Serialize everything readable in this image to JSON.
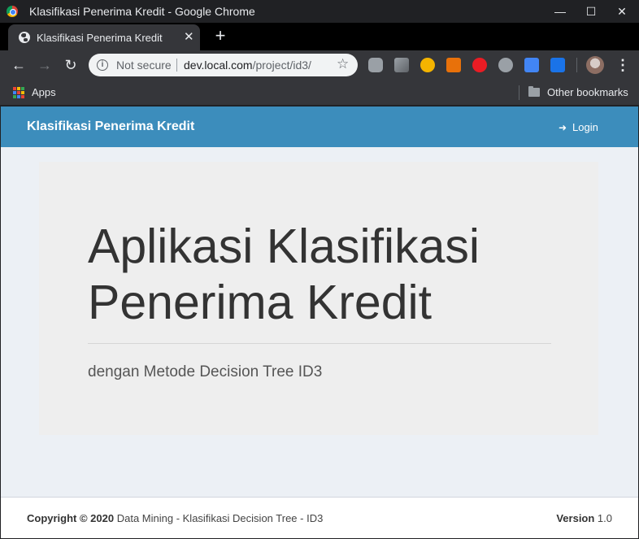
{
  "window": {
    "title": "Klasifikasi Penerima Kredit - Google Chrome",
    "minimize": "—",
    "maximize": "☐",
    "close": "✕"
  },
  "tab": {
    "title": "Klasifikasi Penerima Kredit",
    "close": "✕",
    "new_tab": "+"
  },
  "toolbar": {
    "back": "←",
    "forward": "→",
    "reload": "↻",
    "security_label": "Not secure",
    "url_host": "dev.local.com",
    "url_path": "/project/id3/",
    "star": "☆",
    "menu": "⋮",
    "extensions": [
      "line-icon",
      "play-icon",
      "owl-icon",
      "office-icon",
      "adblock-icon",
      "mailtrack-icon",
      "translate-icon",
      "s-icon",
      "profile-avatar"
    ]
  },
  "bookmarks": {
    "apps": "Apps",
    "other": "Other bookmarks"
  },
  "navbar": {
    "brand": "Klasifikasi Penerima Kredit",
    "login_icon": "➜",
    "login": "Login"
  },
  "jumbotron": {
    "title": "Aplikasi Klasifikasi Penerima Kredit",
    "subtitle": "dengan Metode Decision Tree ID3"
  },
  "footer": {
    "copyright": "Copyright © 2020",
    "text": " Data Mining - Klasifikasi Decision Tree - ID3",
    "version_label": "Version",
    "version": " 1.0"
  },
  "colors": {
    "navbar": "#3c8dbc",
    "content_bg": "#ecf0f5",
    "jumbotron": "#eeeeee"
  }
}
